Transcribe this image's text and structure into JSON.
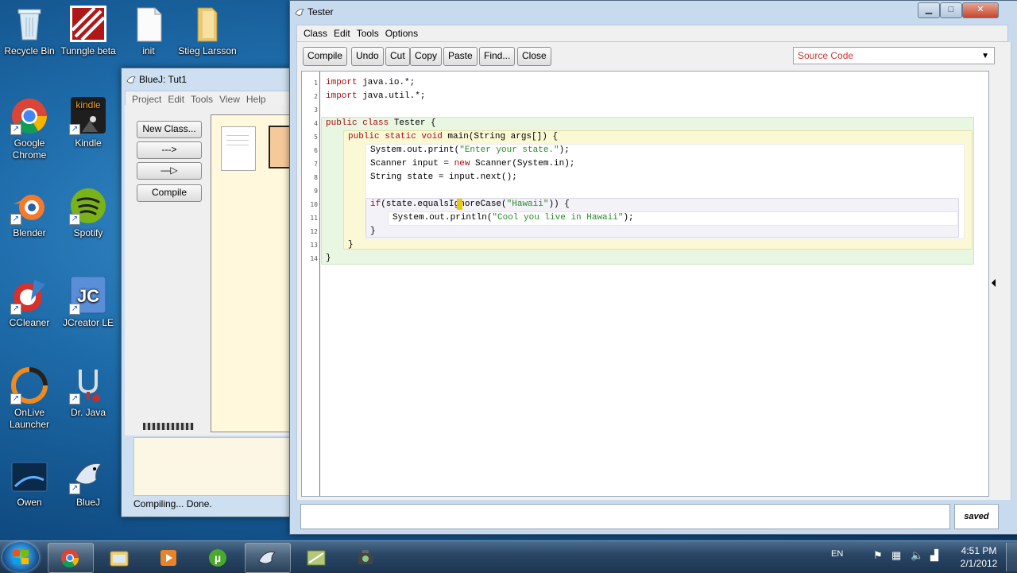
{
  "desktop": {
    "icons": [
      {
        "label": "Recycle Bin"
      },
      {
        "label": "Tunngle beta"
      },
      {
        "label": "init"
      },
      {
        "label": "Stieg Larsson"
      },
      {
        "label": "Google Chrome"
      },
      {
        "label": "Kindle"
      },
      {
        "label": "Blender"
      },
      {
        "label": "Spotify"
      },
      {
        "label": "CCleaner"
      },
      {
        "label": "JCreator LE"
      },
      {
        "label": "OnLive Launcher"
      },
      {
        "label": "Dr. Java"
      },
      {
        "label": "Owen"
      },
      {
        "label": "BlueJ"
      }
    ]
  },
  "bluej": {
    "title": "BlueJ:  Tut1",
    "menu": [
      "Project",
      "Edit",
      "Tools",
      "View",
      "Help"
    ],
    "buttons": {
      "new_class": "New Class...",
      "uses_arrow": "--->",
      "inherit_arrow": "—▷",
      "compile": "Compile"
    },
    "status": "Compiling... Done."
  },
  "editor": {
    "title": "Tester",
    "menu": [
      "Class",
      "Edit",
      "Tools",
      "Options"
    ],
    "toolbar": [
      "Compile",
      "Undo",
      "Cut",
      "Copy",
      "Paste",
      "Find...",
      "Close"
    ],
    "view_select": "Source Code",
    "saved_label": "saved",
    "line_numbers": [
      "1",
      "2",
      "3",
      "4",
      "5",
      "6",
      "7",
      "8",
      "9",
      "10",
      "11",
      "12",
      "13",
      "14"
    ],
    "code_lines": [
      "import java.io.*;",
      "import java.util.*;",
      "",
      "public class Tester {",
      "    public static void main(String args[]) {",
      "        System.out.print(\"Enter your state.\");",
      "        Scanner input = new Scanner(System.in);",
      "        String state = input.next();",
      "",
      "        if(state.equalsIgnoreCase(\"Hawaii\")) {",
      "            System.out.println(\"Cool you live in Hawaii\");",
      "        }",
      "    }",
      "}"
    ]
  },
  "taskbar": {
    "language": "EN",
    "time": "4:51 PM",
    "date": "2/1/2012"
  },
  "colors": {
    "keyword": "#a01010",
    "string": "#2a8a2a",
    "class_scope": "#e9f6e2",
    "method_scope": "#fbf8d6",
    "if_scope": "#f2f2f8",
    "select_text": "#cc3333"
  }
}
